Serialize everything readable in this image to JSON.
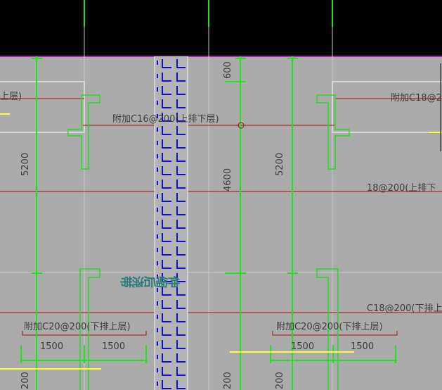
{
  "drawing": {
    "labels": {
      "top_left": "上层)",
      "top_middle": "附加C16@200(上排下层)",
      "top_right": "附加C18@2",
      "mid_right": "18@200(上排下",
      "lower_right": "C18@200(下排上",
      "bottom_left": "附加C20@200(下排上层)",
      "bottom_right": "附加C20@200(下排上层)"
    },
    "band_text": "伸缩后浇带",
    "dimensions": {
      "left_span": "5200",
      "mid_span": "4600",
      "right_span": "5200",
      "top_600": "600",
      "bottom_left_a": "1500",
      "bottom_left_b": "1500",
      "bottom_right_a": "1500",
      "bottom_right_b": "1500",
      "edge_bottom_left": "200",
      "edge_bottom_mid": "200",
      "edge_bottom_right": "200"
    }
  }
}
